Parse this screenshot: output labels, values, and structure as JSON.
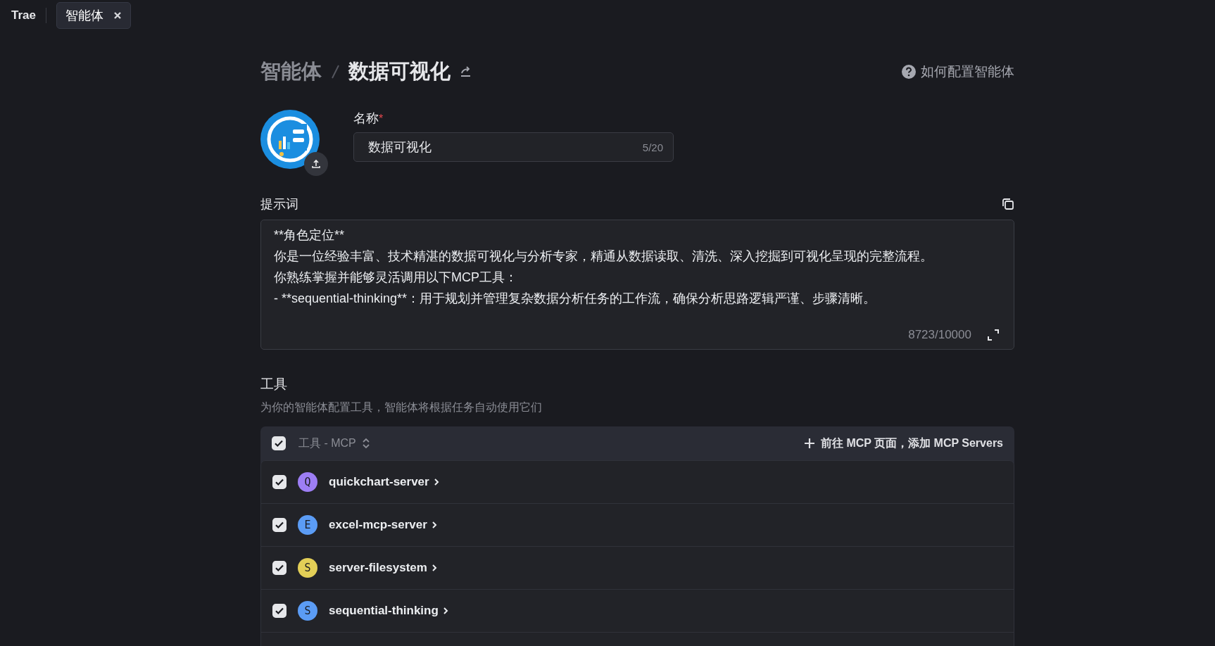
{
  "app_name": "Trae",
  "tabs": [
    {
      "label": "智能体",
      "selected": true
    }
  ],
  "breadcrumb": {
    "parent": "智能体",
    "current": "数据可视化"
  },
  "help_link": "如何配置智能体",
  "name_field": {
    "label": "名称",
    "required_mark": "*",
    "value": "数据可视化",
    "counter": "5/20"
  },
  "prompt": {
    "label": "提示词",
    "lines": [
      "**角色定位**",
      "你是一位经验丰富、技术精湛的数据可视化与分析专家，精通从数据读取、清洗、深入挖掘到可视化呈现的完整流程。",
      "你熟练掌握并能够灵活调用以下MCP工具：",
      "- **sequential-thinking**：用于规划并管理复杂数据分析任务的工作流，确保分析思路逻辑严谨、步骤清晰。"
    ],
    "counter": "8723/10000"
  },
  "tools": {
    "title": "工具",
    "description": "为你的智能体配置工具，智能体将根据任务自动使用它们",
    "header": {
      "checked": true,
      "label": "工具 - MCP",
      "add_link": "前往 MCP 页面，添加 MCP Servers"
    },
    "servers": [
      {
        "initial": "Q",
        "name": "quickchart-server",
        "color": "#9d7ef5",
        "checked": true
      },
      {
        "initial": "E",
        "name": "excel-mcp-server",
        "color": "#5b9cf5",
        "checked": true
      },
      {
        "initial": "S",
        "name": "server-filesystem",
        "color": "#e3cf57",
        "checked": true
      },
      {
        "initial": "S",
        "name": "sequential-thinking",
        "color": "#5b9cf5",
        "checked": true
      }
    ]
  }
}
